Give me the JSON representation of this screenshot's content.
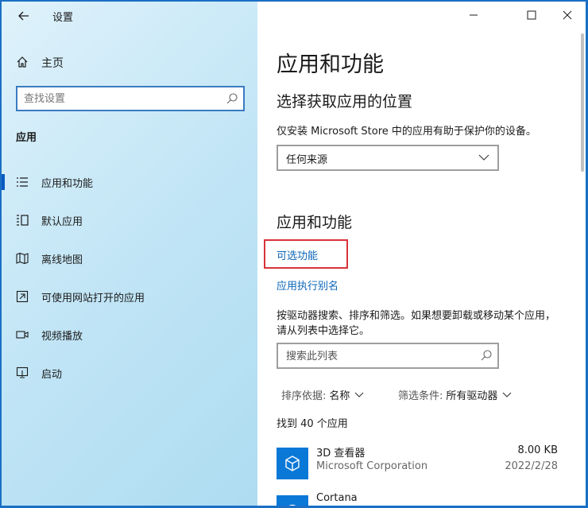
{
  "window": {
    "title": "设置",
    "back_icon": "arrow-left-icon",
    "controls": [
      "minimize-icon",
      "maximize-icon",
      "close-icon"
    ]
  },
  "sidebar": {
    "home_label": "主页",
    "search_placeholder": "查找设置",
    "section_label": "应用",
    "items": [
      {
        "label": "应用和功能",
        "icon": "list-icon",
        "selected": true
      },
      {
        "label": "默认应用",
        "icon": "default-apps-icon",
        "selected": false
      },
      {
        "label": "离线地图",
        "icon": "map-icon",
        "selected": false
      },
      {
        "label": "可使用网站打开的应用",
        "icon": "website-apps-icon",
        "selected": false
      },
      {
        "label": "视频播放",
        "icon": "video-icon",
        "selected": false
      },
      {
        "label": "启动",
        "icon": "startup-icon",
        "selected": false
      }
    ]
  },
  "main": {
    "page_title": "应用和功能",
    "install_section": {
      "heading": "选择获取应用的位置",
      "description": "仅安装 Microsoft Store 中的应用有助于保护你的设备。",
      "dropdown_value": "任何来源"
    },
    "apps_section": {
      "heading": "应用和功能",
      "link_optional": "可选功能",
      "link_alias": "应用执行别名",
      "description": "按驱动器搜索、排序和筛选。如果想要卸载或移动某个应用，请从列表中选择它。",
      "search_placeholder": "搜索此列表",
      "sort_key": "排序依据:",
      "sort_value": "名称",
      "filter_key": "筛选条件:",
      "filter_value": "所有驱动器",
      "count_text": "找到 40 个应用",
      "apps": [
        {
          "name": "3D 查看器",
          "publisher": "Microsoft Corporation",
          "size": "8.00 KB",
          "date": "2022/2/28"
        },
        {
          "name": "Cortana",
          "publisher": "",
          "size": "",
          "date": ""
        }
      ]
    }
  },
  "colors": {
    "accent": "#0a5bbf",
    "link": "#0b65b8",
    "highlight": "#d9333a",
    "app_tile": "#0a78d7"
  }
}
